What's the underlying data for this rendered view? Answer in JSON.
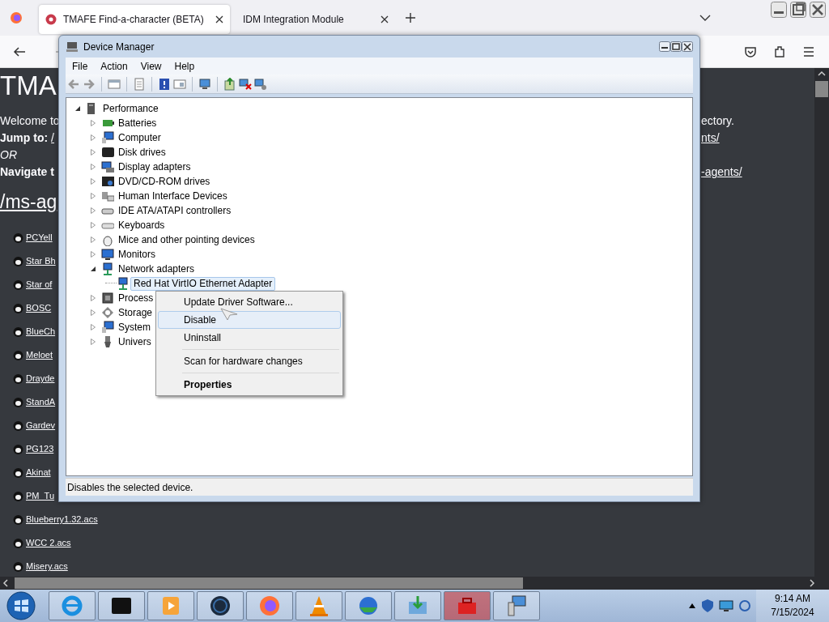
{
  "browser": {
    "tabs": [
      {
        "title": "TMAFE Find-a-character (BETA)",
        "selected": true
      },
      {
        "title": "IDM Integration Module",
        "selected": false
      }
    ]
  },
  "page": {
    "heading": "TMA",
    "lines": [
      {
        "kind": "text",
        "left": "Welcome to",
        "right": "ectory."
      },
      {
        "kind": "jump",
        "label": "Jump to:",
        "left": "/",
        "right": "nts/"
      },
      {
        "kind": "italic",
        "left": "OR"
      },
      {
        "kind": "jump",
        "label": "Navigate t",
        "right": "-agents/"
      }
    ],
    "section": "/ms-ag",
    "files": [
      "PCYell",
      "Star Bh",
      "Star of",
      "BOSC",
      "BlueCh",
      "Meloet",
      "Drayde",
      "StandA",
      "Gardev",
      "PG123",
      "Akinat",
      "PM_Tu",
      "Blueberry1.32.acs",
      "WCC 2.acs",
      "Misery.acs"
    ]
  },
  "device_manager": {
    "title": "Device Manager",
    "menu": [
      "File",
      "Action",
      "View",
      "Help"
    ],
    "tree": {
      "label": "Performance",
      "expanded": true,
      "selected": false,
      "children": [
        {
          "label": "Batteries",
          "expanded": false,
          "selected": false
        },
        {
          "label": "Computer",
          "expanded": false,
          "selected": false
        },
        {
          "label": "Disk drives",
          "expanded": false,
          "selected": false
        },
        {
          "label": "Display adapters",
          "expanded": false,
          "selected": false
        },
        {
          "label": "DVD/CD-ROM drives",
          "expanded": false,
          "selected": false
        },
        {
          "label": "Human Interface Devices",
          "expanded": false,
          "selected": false
        },
        {
          "label": "IDE ATA/ATAPI controllers",
          "expanded": false,
          "selected": false
        },
        {
          "label": "Keyboards",
          "expanded": false,
          "selected": false
        },
        {
          "label": "Mice and other pointing devices",
          "expanded": false,
          "selected": false
        },
        {
          "label": "Monitors",
          "expanded": false,
          "selected": false
        },
        {
          "label": "Network adapters",
          "expanded": true,
          "selected": false,
          "children": [
            {
              "label": "Red Hat VirtIO Ethernet Adapter",
              "selected": true
            }
          ]
        },
        {
          "label": "Process",
          "expanded": false,
          "selected": false
        },
        {
          "label": "Storage",
          "expanded": false,
          "selected": false
        },
        {
          "label": "System",
          "expanded": false,
          "selected": false
        },
        {
          "label": "Univers",
          "expanded": false,
          "selected": false
        }
      ]
    },
    "context_menu": [
      {
        "kind": "item",
        "label": "Update Driver Software...",
        "selected": false,
        "default": false
      },
      {
        "kind": "item",
        "label": "Disable",
        "selected": true,
        "default": false
      },
      {
        "kind": "item",
        "label": "Uninstall",
        "selected": false,
        "default": false
      },
      {
        "kind": "separator"
      },
      {
        "kind": "item",
        "label": "Scan for hardware changes",
        "selected": false,
        "default": false
      },
      {
        "kind": "separator"
      },
      {
        "kind": "item",
        "label": "Properties",
        "selected": false,
        "default": true
      }
    ],
    "status_bar": "Disables the selected device."
  },
  "taskbar": {
    "time": "9:14 AM",
    "date": "7/15/2024"
  }
}
